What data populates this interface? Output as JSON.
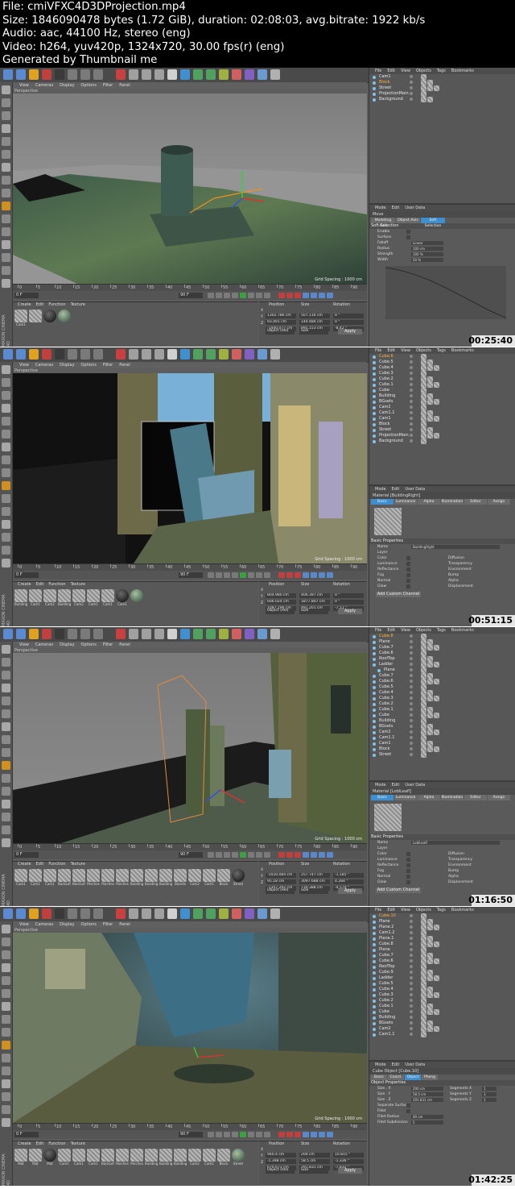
{
  "header": {
    "file": "File: cmiVFXC4D3DProjection.mp4",
    "size": "Size: 1846090478 bytes (1.72 GiB), duration: 02:08:03, avg.bitrate: 1922 kb/s",
    "audio": "Audio: aac, 44100 Hz, stereo (eng)",
    "video": "Video: h264, yuv420p, 1324x720, 30.00 fps(r) (eng)",
    "generator": "Generated by Thumbnail me"
  },
  "common": {
    "viewport_menu": [
      "View",
      "Cameras",
      "Display",
      "Options",
      "Filter",
      "Panel"
    ],
    "viewport_title": "Perspective",
    "grid_spacing": "Grid Spacing : 1000 cm",
    "mat_menu": [
      "Create",
      "Edit",
      "Function",
      "Texture"
    ],
    "obj_menu": [
      "File",
      "Edit",
      "View",
      "Objects",
      "Tags",
      "Bookmarks"
    ],
    "attr_menu": [
      "Mode",
      "Edit",
      "User Data"
    ],
    "coord_headers": [
      "Position",
      "Size",
      "Rotation"
    ],
    "object_rel": "Object (Rel)",
    "size_mode": "Size",
    "apply": "Apply",
    "maxon": "MAXON CINEMA 4D",
    "frame_start": "0 F",
    "frame_end": "90 F",
    "timeline_ticks": [
      "0",
      "5",
      "10",
      "15",
      "20",
      "25",
      "30",
      "35",
      "40",
      "45",
      "50",
      "55",
      "60",
      "65",
      "70",
      "75",
      "80",
      "85",
      "90"
    ]
  },
  "frames": [
    {
      "timestamp": "00:25:40",
      "objects": [
        {
          "name": "Cam1",
          "sel": false
        },
        {
          "name": "Block",
          "sel": true
        },
        {
          "name": "Street",
          "sel": false
        },
        {
          "name": "ProjectionMain",
          "sel": false
        },
        {
          "name": "Background",
          "sel": false
        }
      ],
      "materials": [
        {
          "label": "Cam1",
          "style": "hatch"
        },
        {
          "label": "",
          "style": "hatch"
        },
        {
          "label": "",
          "style": "ball-dark"
        },
        {
          "label": "",
          "style": "ball-green"
        }
      ],
      "coords": {
        "x": [
          "1302.786 cm",
          "507.116 cm",
          "0 °"
        ],
        "y": [
          "93.491 cm",
          "144.484 cm",
          "0 °"
        ],
        "z": [
          "-1440.077 cm",
          "895.153 cm",
          "-8.42 °"
        ]
      },
      "attr": {
        "title": "Move",
        "tabs": [
          "Modeling Axis",
          "Object Axis",
          "Soft Selection"
        ],
        "section": "Soft Selection",
        "props": [
          "Enable",
          "Surface",
          "Falloff",
          "Radius",
          "Strength",
          "Width"
        ],
        "values": [
          "",
          "",
          "Linear",
          "100 cm",
          "100 %",
          "50 %"
        ]
      }
    },
    {
      "timestamp": "00:51:15",
      "objects": [
        {
          "name": "Cube.6",
          "sel": true
        },
        {
          "name": "Cube.5",
          "sel": false
        },
        {
          "name": "Cube.4",
          "sel": false
        },
        {
          "name": "Cube.3",
          "sel": false
        },
        {
          "name": "Cube.2",
          "sel": false
        },
        {
          "name": "Cube.1",
          "sel": false
        },
        {
          "name": "Cube",
          "sel": false
        },
        {
          "name": "Building",
          "sel": false
        },
        {
          "name": "BGsets",
          "sel": false
        },
        {
          "name": "Cam2",
          "sel": false
        },
        {
          "name": "Cam1.1",
          "sel": false
        },
        {
          "name": "Cam1",
          "sel": false
        },
        {
          "name": "Block",
          "sel": false
        },
        {
          "name": "Street",
          "sel": false
        },
        {
          "name": "ProjectionMain",
          "sel": false
        },
        {
          "name": "Background",
          "sel": false
        }
      ],
      "materials": [
        {
          "label": "Building",
          "style": "hatch"
        },
        {
          "label": "Cam1",
          "style": "hatch"
        },
        {
          "label": "Cam2",
          "style": "hatch"
        },
        {
          "label": "Building",
          "style": "hatch"
        },
        {
          "label": "Cam2",
          "style": "hatch"
        },
        {
          "label": "Cam1",
          "style": "hatch"
        },
        {
          "label": "Cam1",
          "style": "hatch"
        },
        {
          "label": "Cam1",
          "style": "ball-dark"
        },
        {
          "label": "",
          "style": "ball-green"
        }
      ],
      "coords": {
        "x": [
          "804.980 cm",
          "406.397 cm",
          "0 °"
        ],
        "y": [
          "606.024 cm",
          "1877.807 cm",
          "0 °"
        ],
        "z": [
          "1087.196 cm",
          "491.201 cm",
          "-7.11 °"
        ]
      },
      "attr": {
        "title": "Material [BuildingRight]",
        "tabs": [
          "Basic",
          "Luminance",
          "Alpha",
          "Illumination",
          "Editor",
          "Assign"
        ],
        "section": "Basic Properties",
        "props": [
          "Name",
          "Layer",
          "Color",
          "Luminance",
          "Reflectance",
          "Fog",
          "Normal",
          "Glow"
        ],
        "values": [
          "BuildingRight",
          "",
          "",
          "",
          "",
          "",
          "",
          ""
        ],
        "props2": [
          "Diffusion",
          "Transparency",
          "Environment",
          "Bump",
          "Alpha",
          "Displacement"
        ],
        "extra": "Add Custom Channel"
      }
    },
    {
      "timestamp": "01:16:50",
      "objects": [
        {
          "name": "Cube.8",
          "sel": true
        },
        {
          "name": "Plane",
          "sel": false
        },
        {
          "name": "Cube.7",
          "sel": false
        },
        {
          "name": "Cube.6",
          "sel": false
        },
        {
          "name": "RoofTop",
          "sel": false
        },
        {
          "name": "Ladder",
          "sel": false
        },
        {
          "name": "Plane",
          "sel": false
        },
        {
          "name": "Cube.7",
          "sel": false
        },
        {
          "name": "Cube.6",
          "sel": false
        },
        {
          "name": "Cube.5",
          "sel": false
        },
        {
          "name": "Cube.4",
          "sel": false
        },
        {
          "name": "Cube.3",
          "sel": false
        },
        {
          "name": "Cube.2",
          "sel": false
        },
        {
          "name": "Cube.1",
          "sel": false
        },
        {
          "name": "Cube",
          "sel": false
        },
        {
          "name": "Building",
          "sel": false
        },
        {
          "name": "BGsets",
          "sel": false
        },
        {
          "name": "Cam2",
          "sel": false
        },
        {
          "name": "Cam1.1",
          "sel": false
        },
        {
          "name": "Cam1",
          "sel": false
        },
        {
          "name": "Block",
          "sel": false
        },
        {
          "name": "Street",
          "sel": false
        }
      ],
      "materials": [
        {
          "label": "Cam1",
          "style": "hatch"
        },
        {
          "label": "Cam1",
          "style": "hatch"
        },
        {
          "label": "Cam1",
          "style": "hatch"
        },
        {
          "label": "BackLeft",
          "style": "hatch"
        },
        {
          "label": "BackLeft",
          "style": "hatch"
        },
        {
          "label": "Porches",
          "style": "hatch"
        },
        {
          "label": "Porches",
          "style": "hatch"
        },
        {
          "label": "Porches",
          "style": "hatch"
        },
        {
          "label": "Building",
          "style": "hatch"
        },
        {
          "label": "Building",
          "style": "hatch"
        },
        {
          "label": "Building",
          "style": "hatch"
        },
        {
          "label": "Boards",
          "style": "hatch"
        },
        {
          "label": "Cam2",
          "style": "hatch"
        },
        {
          "label": "Cam1",
          "style": "hatch"
        },
        {
          "label": "Block",
          "style": "hatch"
        },
        {
          "label": "Street",
          "style": "ball-dark"
        }
      ],
      "coords": {
        "x": [
          "-1020.084 cm",
          "257.747 cm",
          "-1.185 °"
        ],
        "y": [
          "95.18 cm",
          "3097.688 cm",
          "4.284 °"
        ],
        "z": [
          "-1347.292 cm",
          "730.388 cm",
          "-4.579 °"
        ]
      },
      "attr": {
        "title": "Material [LoblLeafl]",
        "tabs": [
          "Basic",
          "Luminance",
          "Alpha",
          "Illumination",
          "Editor",
          "Assign"
        ],
        "section": "Basic Properties",
        "props": [
          "Name",
          "Layer",
          "Color",
          "Luminance",
          "Reflectance",
          "Fog",
          "Normal",
          "Glow"
        ],
        "values": [
          "LoblLeafl",
          "",
          "",
          "",
          "",
          "",
          "",
          ""
        ],
        "props2": [
          "Diffusion",
          "Transparency",
          "Environment",
          "Bump",
          "Alpha",
          "Displacement"
        ],
        "extra": "Add Custom Channel"
      }
    },
    {
      "timestamp": "01:42:25",
      "objects": [
        {
          "name": "Cube.10",
          "sel": true
        },
        {
          "name": "Plane",
          "sel": false
        },
        {
          "name": "Plane.2",
          "sel": false
        },
        {
          "name": "Cam1.2",
          "sel": false
        },
        {
          "name": "Plane.1",
          "sel": false
        },
        {
          "name": "Cube.8",
          "sel": false
        },
        {
          "name": "Plane",
          "sel": false
        },
        {
          "name": "Cube.7",
          "sel": false
        },
        {
          "name": "Cube.6",
          "sel": false
        },
        {
          "name": "RoofTop",
          "sel": false
        },
        {
          "name": "Cube.9",
          "sel": false
        },
        {
          "name": "Ladder",
          "sel": false
        },
        {
          "name": "Cube.5",
          "sel": false
        },
        {
          "name": "Cube.4",
          "sel": false
        },
        {
          "name": "Cube.3",
          "sel": false
        },
        {
          "name": "Cube.2",
          "sel": false
        },
        {
          "name": "Cube.1",
          "sel": false
        },
        {
          "name": "Cube",
          "sel": false
        },
        {
          "name": "Building",
          "sel": false
        },
        {
          "name": "BGsets",
          "sel": false
        },
        {
          "name": "Cam2",
          "sel": false
        },
        {
          "name": "Cam1.1",
          "sel": false
        }
      ],
      "materials": [
        {
          "label": "Mat",
          "style": "hatch"
        },
        {
          "label": "Mat",
          "style": "hatch"
        },
        {
          "label": "Mat",
          "style": "ball-dark"
        },
        {
          "label": "Cam1",
          "style": "hatch"
        },
        {
          "label": "Cam1",
          "style": "hatch"
        },
        {
          "label": "Cam1",
          "style": "hatch"
        },
        {
          "label": "BackLeft",
          "style": "hatch"
        },
        {
          "label": "Porches",
          "style": "hatch"
        },
        {
          "label": "Porches",
          "style": "hatch"
        },
        {
          "label": "Building",
          "style": "hatch"
        },
        {
          "label": "Building",
          "style": "hatch"
        },
        {
          "label": "Building",
          "style": "hatch"
        },
        {
          "label": "Cam2",
          "style": "hatch"
        },
        {
          "label": "Cam1",
          "style": "hatch"
        },
        {
          "label": "Block",
          "style": "hatch"
        },
        {
          "label": "Street",
          "style": "ball-green"
        }
      ],
      "coords": {
        "x": [
          "940.4 cm",
          "200 cm",
          "10.815 °"
        ],
        "y": [
          "-1.398 cm",
          "58.5 cm",
          "-1.336 °"
        ],
        "z": [
          "670.673 cm",
          "291.831 cm",
          "-7.832 °"
        ]
      },
      "attr": {
        "title": "Cube Object [Cube.10]",
        "tabs": [
          "Basic",
          "Coord.",
          "Object",
          "Phong"
        ],
        "section": "Object Properties",
        "props": [
          "Size . X",
          "Size . Y",
          "Size . Z",
          "Separate Surfaces",
          "Fillet",
          "Fillet Radius",
          "Fillet Subdivision"
        ],
        "values": [
          "200 cm",
          "58.5 cm",
          "291.831 cm",
          "",
          "",
          "40 cm",
          "5"
        ],
        "props2": [
          "Segments X",
          "Segments Y",
          "Segments Z"
        ],
        "values2": [
          "1",
          "1",
          "1"
        ]
      }
    }
  ]
}
